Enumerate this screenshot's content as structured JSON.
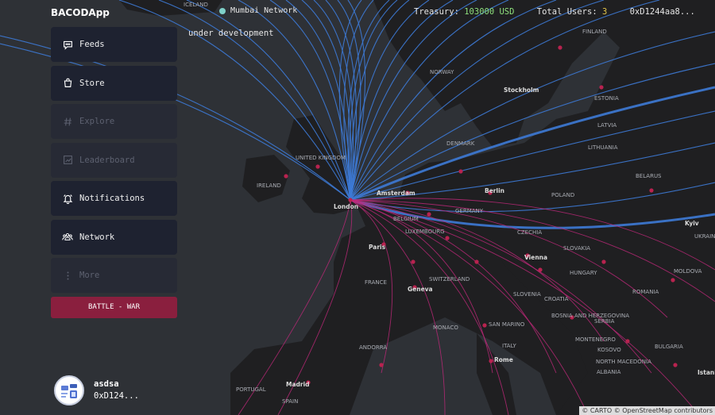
{
  "header": {
    "app_title": "BACODApp",
    "network_label": "Mumbai Network",
    "treasury_label": "Treasury:",
    "treasury_value": "103000 USD",
    "users_label": "Total Users:",
    "users_value": "3",
    "wallet": "0xD1244aa8..."
  },
  "status_text": "under development",
  "sidebar": {
    "items": [
      {
        "label": "Feeds",
        "icon": "chat-bubble-icon",
        "enabled": true
      },
      {
        "label": "Store",
        "icon": "shopping-bag-icon",
        "enabled": true
      },
      {
        "label": "Explore",
        "icon": "hashtag-icon",
        "enabled": false
      },
      {
        "label": "Leaderboard",
        "icon": "chart-icon",
        "enabled": false
      },
      {
        "label": "Notifications",
        "icon": "bell-icon",
        "enabled": true
      },
      {
        "label": "Network",
        "icon": "people-icon",
        "enabled": true
      },
      {
        "label": "More",
        "icon": "more-vertical-icon",
        "enabled": false
      }
    ],
    "battle_label": "BATTLE - WAR"
  },
  "profile": {
    "name": "asdsa",
    "address": "0xD124..."
  },
  "map": {
    "labels": {
      "united_kingdom": "UNITED KINGDOM",
      "ireland": "IRELAND",
      "london": "London",
      "amsterdam": "Amsterdam",
      "belgium": "BELGIUM",
      "luxembourg": "LUXEMBOURG",
      "paris": "Paris",
      "france": "FRANCE",
      "switzerland": "SWITZERLAND",
      "geneva": "Geneva",
      "monaco": "MONACO",
      "andorra": "ANDORRA",
      "portugal": "PORTUGAL",
      "madrid": "Madrid",
      "spain": "SPAIN",
      "germany": "GERMANY",
      "berlin": "Berlin",
      "denmark": "DENMARK",
      "norway": "NORWAY",
      "stockholm": "Stockholm",
      "finland": "FINLAND",
      "estonia": "ESTONIA",
      "latvia": "LATVIA",
      "lithuania": "LITHUANIA",
      "belarus": "BELARUS",
      "poland": "POLAND",
      "czechia": "CZECHIA",
      "slovakia": "SLOVAKIA",
      "vienna": "Vienna",
      "hungary": "HUNGARY",
      "slovenia": "SLOVENIA",
      "croatia": "CROATIA",
      "san_marino": "SAN MARINO",
      "italy": "ITALY",
      "rome": "Rome",
      "bosnia": "BOSNIA AND HERZEGOVINA",
      "serbia": "SERBIA",
      "montenegro": "MONTENEGRO",
      "kosovo": "KOSOVO",
      "north_macedonia": "NORTH MACEDONIA",
      "albania": "ALBANIA",
      "bulgaria": "BULGARIA",
      "romania": "ROMANIA",
      "moldova": "MOLDOVA",
      "ukraine": "UKRAINE",
      "kyiv": "Kyiv",
      "istanbul": "Istanb",
      "iceland": "ICELAND"
    },
    "attribution": "© CARTO © OpenStreetMap contributors",
    "colors": {
      "land": "#1f1f21",
      "water": "#2e3136",
      "route_primary": "#3d7ad6",
      "route_secondary": "#c0287a",
      "city_dot": "#b8234f"
    }
  }
}
